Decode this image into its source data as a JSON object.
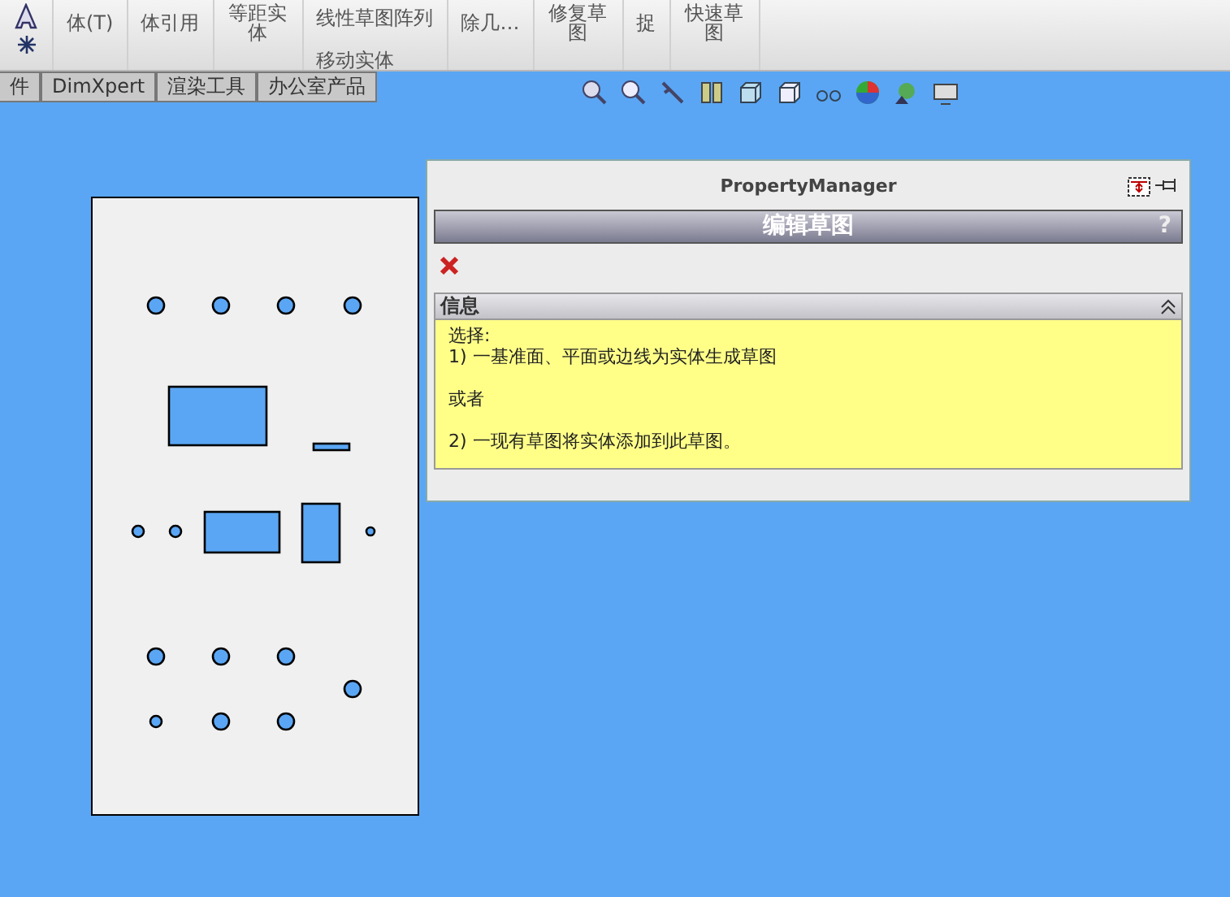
{
  "toolbar": {
    "items": [
      {
        "kind": "big",
        "label": "体(T)"
      },
      {
        "kind": "big",
        "label": "体引用"
      },
      {
        "kind": "big",
        "label": "等距实体"
      },
      {
        "kind": "stack",
        "labels": [
          "线性草图阵列",
          "移动实体"
        ]
      },
      {
        "kind": "big",
        "label": "除几…"
      },
      {
        "kind": "big",
        "label": "修复草图"
      },
      {
        "kind": "big",
        "label": "捉"
      },
      {
        "kind": "big",
        "label": "快速草图"
      }
    ]
  },
  "tabs": [
    {
      "label": "件",
      "selected": false
    },
    {
      "label": "DimXpert",
      "selected": false
    },
    {
      "label": "渲染工具",
      "selected": false
    },
    {
      "label": "办公室产品",
      "selected": false
    }
  ],
  "property_manager": {
    "title": "PropertyManager",
    "header": "编辑草图",
    "help": "?",
    "info": {
      "title": "信息",
      "expanded": true,
      "paragraphs": [
        {
          "lines": [
            "选择:",
            "1) 一基准面、平面或边线为实体生成草图"
          ]
        },
        {
          "lines": [
            "或者"
          ]
        },
        {
          "lines": [
            "2) 一现有草图将实体添加到此草图。"
          ]
        }
      ]
    }
  }
}
